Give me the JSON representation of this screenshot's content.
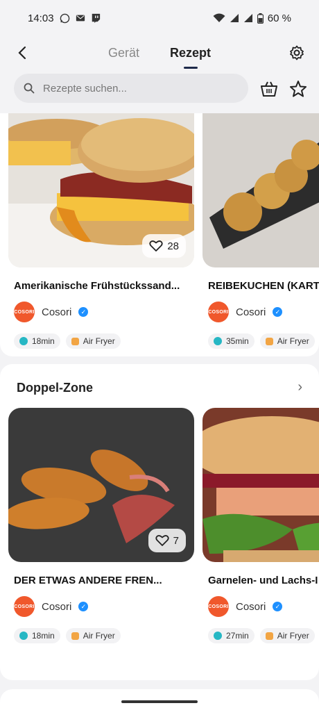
{
  "status": {
    "time": "14:03",
    "battery": "60 %"
  },
  "header": {
    "tabs": [
      "Gerät",
      "Rezept"
    ],
    "active_tab": "Rezept"
  },
  "search": {
    "placeholder": "Rezepte suchen..."
  },
  "section1": {
    "cards": [
      {
        "title": "Amerikanische Frühstückssand...",
        "likes": "28",
        "author": "Cosori",
        "logo_text": "COSORI",
        "time": "18min",
        "device": "Air Fryer"
      },
      {
        "title": "REIBEKUCHEN (KART",
        "author": "Cosori",
        "logo_text": "COSORI",
        "time": "35min",
        "device": "Air Fryer"
      }
    ]
  },
  "section2": {
    "title": "Doppel-Zone",
    "more": "›",
    "cards": [
      {
        "title": "DER ETWAS ANDERE FREN...",
        "likes": "7",
        "author": "Cosori",
        "logo_text": "COSORI",
        "time": "18min",
        "device": "Air Fryer"
      },
      {
        "title": "Garnelen- und Lachs-I",
        "author": "Cosori",
        "logo_text": "COSORI",
        "time": "27min",
        "device": "Air Fryer"
      }
    ]
  },
  "colors": {
    "brand": "#f0582c",
    "accent": "#1e2a4a",
    "verified": "#1e90ff"
  }
}
